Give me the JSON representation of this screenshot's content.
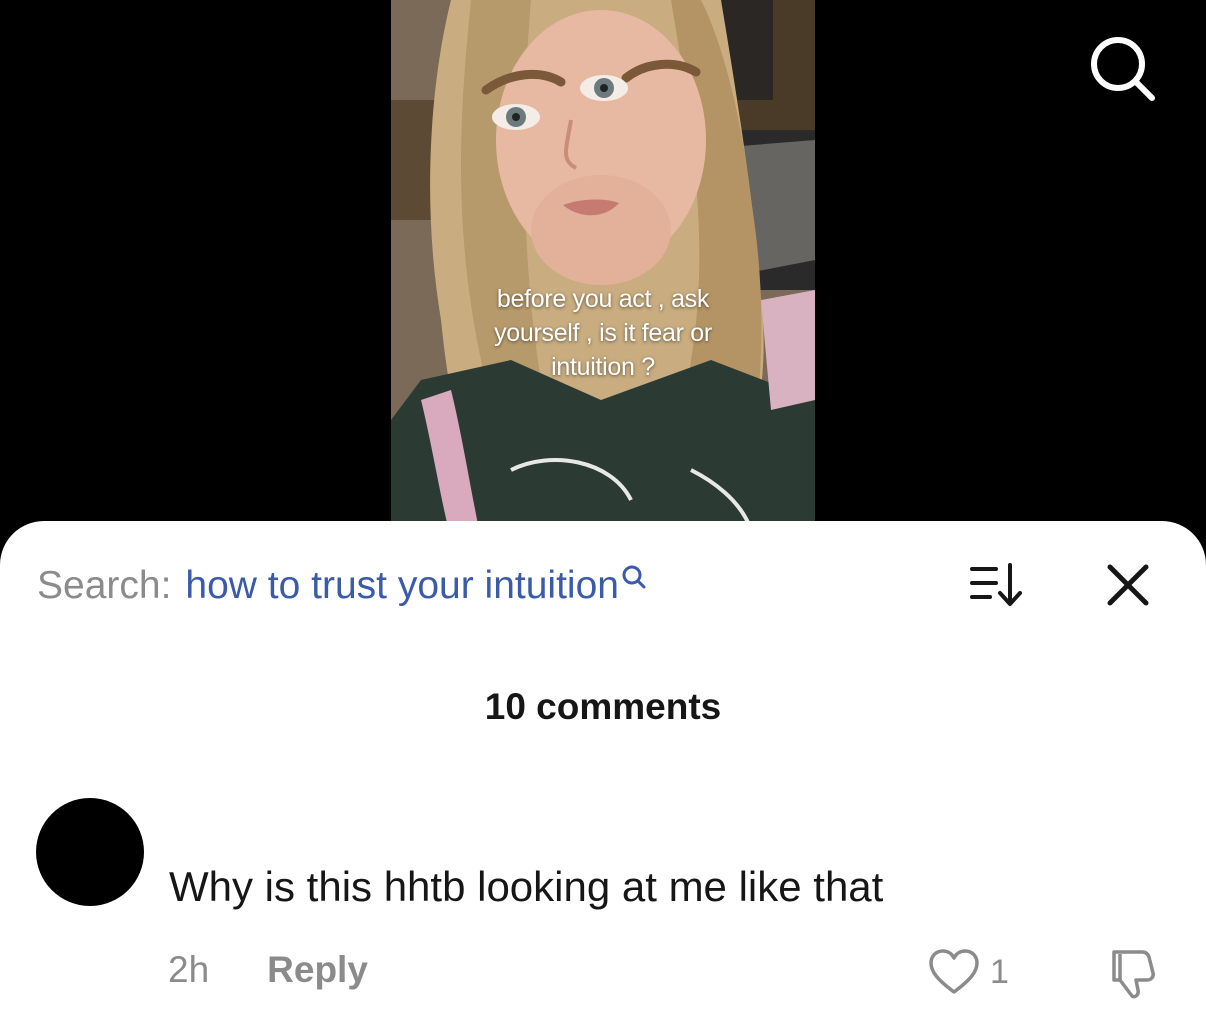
{
  "video": {
    "caption_lines": [
      "before you act , ask",
      "yourself , is it fear or",
      "intuition ?"
    ]
  },
  "header": {
    "search_icon": "search-icon"
  },
  "comments_panel": {
    "search_prefix": "Search:",
    "search_query": "how to trust your intuition",
    "query_icon": "search-icon",
    "sort_icon": "sort-icon",
    "close_icon": "close-icon",
    "count_label": "10 comments",
    "comments": [
      {
        "text": "Why is this hhtb looking at me like that",
        "time": "2h",
        "reply_label": "Reply",
        "likes": "1",
        "like_icon": "heart-icon",
        "dislike_icon": "thumbs-down-icon"
      }
    ]
  },
  "colors": {
    "query_link": "#3b5ba9",
    "secondary_text": "#8b8b8b",
    "primary_text": "#161616"
  }
}
